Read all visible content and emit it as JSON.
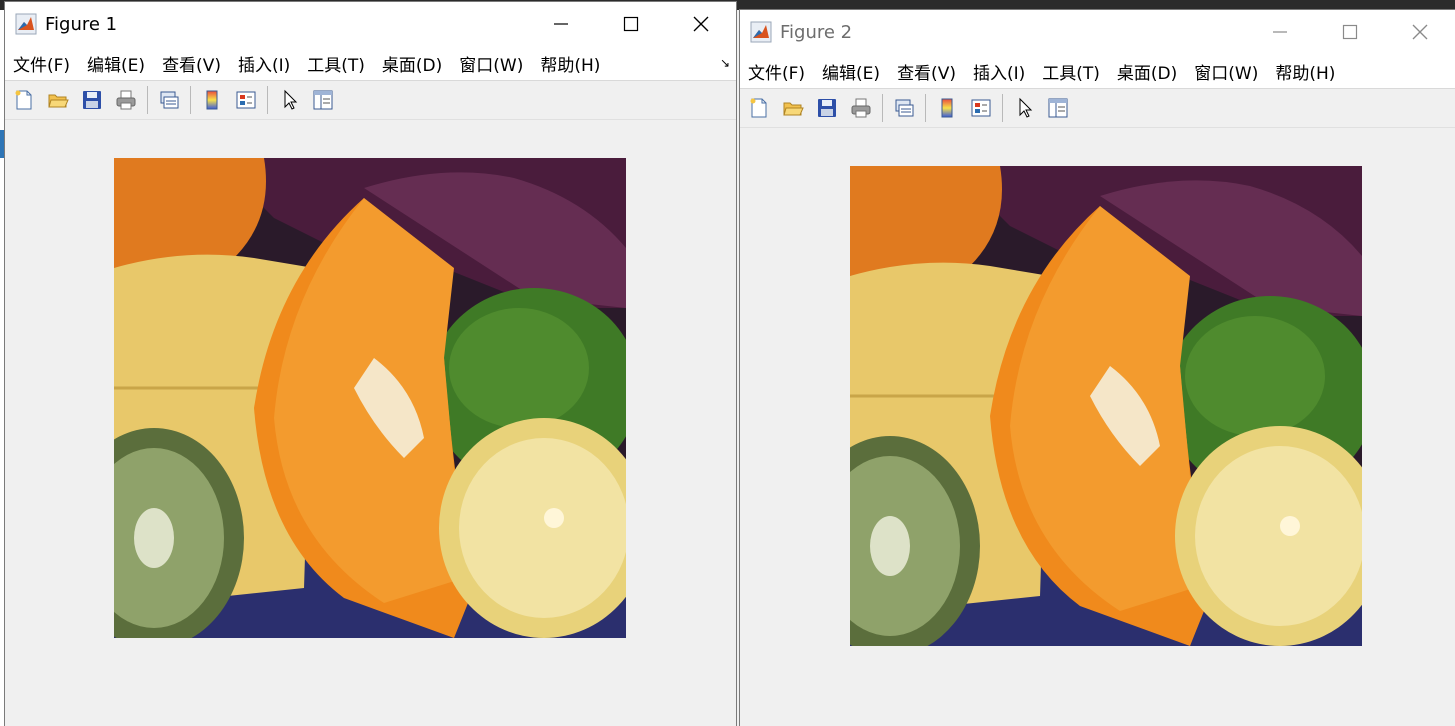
{
  "figure1": {
    "title": "Figure 1",
    "menu": [
      "文件(F)",
      "编辑(E)",
      "查看(V)",
      "插入(I)",
      "工具(T)",
      "桌面(D)",
      "窗口(W)",
      "帮助(H)"
    ]
  },
  "figure2": {
    "title": "Figure 2",
    "menu": [
      "文件(F)",
      "编辑(E)",
      "查看(V)",
      "插入(I)",
      "工具(T)",
      "桌面(D)",
      "窗口(W)",
      "帮助(H)"
    ]
  },
  "toolbar_icons": [
    "new-figure-icon",
    "open-file-icon",
    "save-icon",
    "print-icon",
    "link-figure-icon",
    "colorbar-icon",
    "legend-icon",
    "pointer-icon",
    "property-inspector-icon"
  ],
  "image_subject": "fruit photograph: orange slice, lemon, lime, kiwi, banana, red cabbage",
  "colors": {
    "titlebar": "#ffffff",
    "window_bg": "#f0f0f0",
    "inactive_title": "#6d6d6d",
    "orange": "#f08a1c",
    "lime": "#3f7a26",
    "lemon": "#e8d27a",
    "cabbage": "#4a1c3c"
  }
}
